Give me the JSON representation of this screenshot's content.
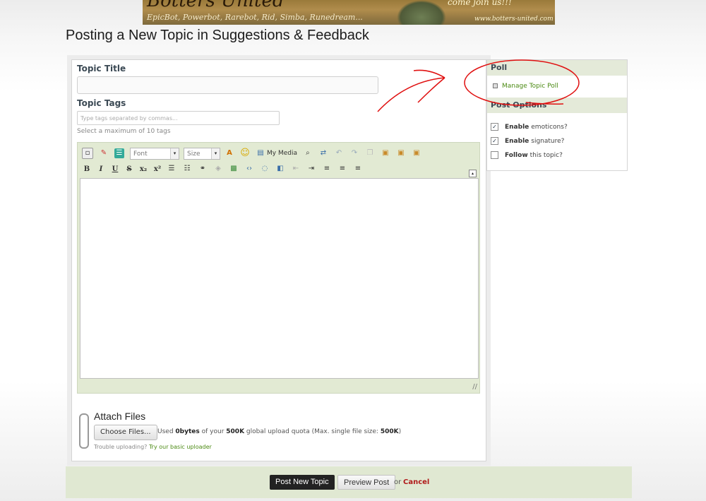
{
  "banner": {
    "title": "Botters United",
    "bots": "EpicBot, Powerbot, Rarebot, Rid, Simba, Runedream...",
    "join": "come join us!!!",
    "url": "www.botters-united.com"
  },
  "page_title": "Posting a New Topic in Suggestions & Feedback",
  "form": {
    "topic_title_label": "Topic Title",
    "topic_title_value": "",
    "topic_tags_label": "Topic Tags",
    "tags_placeholder": "Type tags separated by commas...",
    "tags_hint": "Select a maximum of 10 tags"
  },
  "editor": {
    "font_select": "Font",
    "size_select": "Size",
    "my_media": "My Media",
    "format_buttons": [
      "B",
      "I",
      "U",
      "S",
      "x₂",
      "x²"
    ],
    "content": ""
  },
  "attach": {
    "title": "Attach Files",
    "choose_button": "Choose Files...",
    "quota_prefix": "Used",
    "quota_used": "0bytes",
    "quota_mid": "of your",
    "quota_total": "500K",
    "quota_mid2": "global upload quota (Max. single file size:",
    "quota_max": "500K",
    "quota_end": ")",
    "trouble_text": "Trouble uploading?",
    "trouble_link": "Try our basic uploader"
  },
  "sidebar": {
    "poll_header": "Poll",
    "poll_link": "Manage Topic Poll",
    "options_header": "Post Options",
    "options": [
      {
        "bold": "Enable",
        "rest": "emoticons?",
        "checked": true
      },
      {
        "bold": "Enable",
        "rest": "signature?",
        "checked": true
      },
      {
        "bold": "Follow",
        "rest": "this topic?",
        "checked": false
      }
    ]
  },
  "footer": {
    "post_button": "Post New Topic",
    "preview_button": "Preview Post",
    "or_text": "or",
    "cancel_link": "Cancel"
  },
  "colors": {
    "accent_green": "#4b8a13",
    "header_bg": "#e4ead9",
    "annotation_red": "#e01010",
    "cancel_red": "#b01a1a"
  }
}
